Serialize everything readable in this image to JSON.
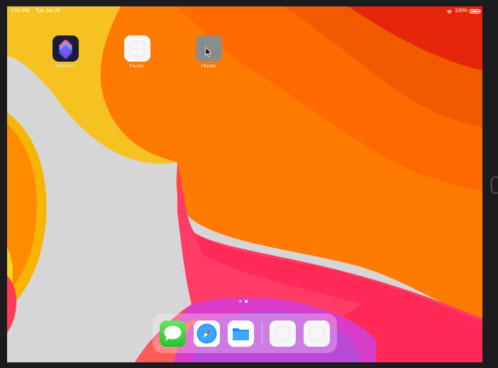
{
  "status_bar": {
    "time": "2:50 PM",
    "date": "Tue Jan 28",
    "battery": "100%",
    "wifi_icon": "wifi-icon",
    "battery_icon": "battery-icon"
  },
  "home_apps": [
    {
      "label": "Shortcuts",
      "icon": "shortcuts-icon"
    },
    {
      "label": "Flixster",
      "icon": "placeholder-icon"
    },
    {
      "label": "Flixster",
      "icon": "placeholder-icon-selected"
    }
  ],
  "page_indicator": {
    "pages": 2,
    "current": 2
  },
  "dock": [
    {
      "name": "Messages",
      "icon": "messages-icon"
    },
    {
      "name": "Safari",
      "icon": "safari-icon"
    },
    {
      "name": "Files",
      "icon": "files-icon"
    },
    {
      "name": "recent-app-1",
      "icon": "placeholder-icon"
    },
    {
      "name": "recent-app-2",
      "icon": "placeholder-icon"
    }
  ],
  "colors": {
    "wallpaper_orange": "#ff7a00",
    "wallpaper_red": "#e6170a",
    "wallpaper_pink": "#ff3c66",
    "wallpaper_yellow": "#f7c21a",
    "wallpaper_grey": "#d6d6d6"
  }
}
